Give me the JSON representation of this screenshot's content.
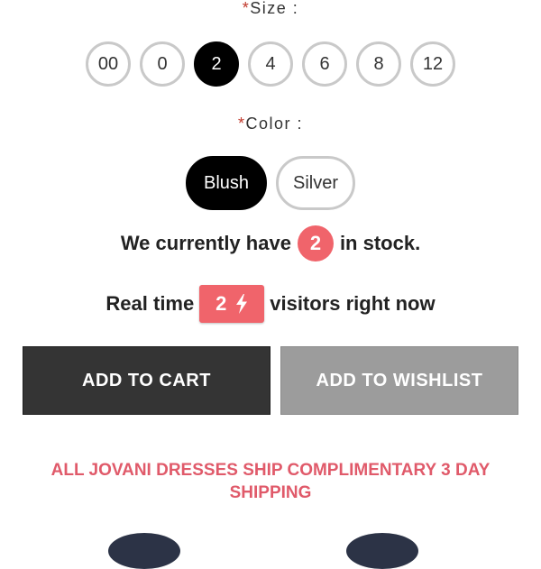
{
  "size": {
    "required_mark": "*",
    "label": "Size :",
    "options": [
      "00",
      "0",
      "2",
      "4",
      "6",
      "8",
      "12"
    ],
    "selected": "2"
  },
  "color": {
    "required_mark": "*",
    "label": "Color :",
    "options": [
      "Blush",
      "Silver"
    ],
    "selected": "Blush"
  },
  "stock": {
    "prefix": "We currently have",
    "count": "2",
    "suffix": "in stock."
  },
  "visitors": {
    "prefix": "Real time",
    "count": "2",
    "icon": "lightning-bolt-icon",
    "suffix": "visitors right now"
  },
  "buttons": {
    "add_to_cart": "ADD TO CART",
    "add_to_wishlist": "ADD TO WISHLIST"
  },
  "shipping_notice": "ALL JOVANI DRESSES SHIP COMPLIMENTARY 3 DAY SHIPPING",
  "colors": {
    "accent": "#f0646b",
    "shipping_text": "#e05a6a",
    "cart_button": "#343434",
    "wishlist_button": "#9c9c9c"
  }
}
